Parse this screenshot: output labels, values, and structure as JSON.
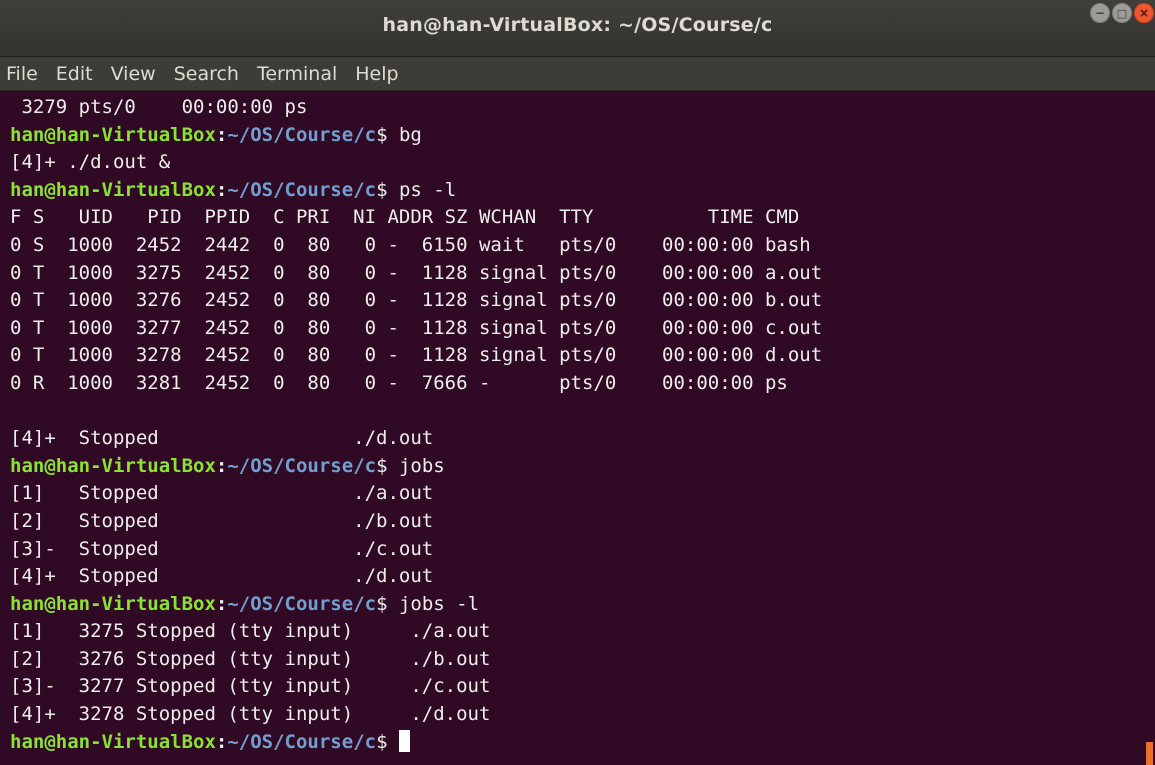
{
  "window": {
    "title": "han@han-VirtualBox: ~/OS/Course/c"
  },
  "menu": [
    "File",
    "Edit",
    "View",
    "Search",
    "Terminal",
    "Help"
  ],
  "prompt": {
    "user": "han@han-VirtualBox",
    "path": "~/OS/Course/c"
  },
  "lines": [
    {
      "text": " 3279 pts/0    00:00:00 ps"
    },
    {
      "user": "han@han-VirtualBox",
      "sep": ":",
      "path": "~/OS/Course/c",
      "cmd": "$ bg"
    },
    {
      "text": "[4]+ ./d.out &"
    },
    {
      "user": "han@han-VirtualBox",
      "sep": ":",
      "path": "~/OS/Course/c",
      "cmd": "$ ps -l"
    },
    {
      "text": "F S   UID   PID  PPID  C PRI  NI ADDR SZ WCHAN  TTY          TIME CMD"
    },
    {
      "text": "0 S  1000  2452  2442  0  80   0 -  6150 wait   pts/0    00:00:00 bash"
    },
    {
      "text": "0 T  1000  3275  2452  0  80   0 -  1128 signal pts/0    00:00:00 a.out"
    },
    {
      "text": "0 T  1000  3276  2452  0  80   0 -  1128 signal pts/0    00:00:00 b.out"
    },
    {
      "text": "0 T  1000  3277  2452  0  80   0 -  1128 signal pts/0    00:00:00 c.out"
    },
    {
      "text": "0 T  1000  3278  2452  0  80   0 -  1128 signal pts/0    00:00:00 d.out"
    },
    {
      "text": "0 R  1000  3281  2452  0  80   0 -  7666 -      pts/0    00:00:00 ps"
    },
    {
      "text": ""
    },
    {
      "text": "[4]+  Stopped                 ./d.out"
    },
    {
      "user": "han@han-VirtualBox",
      "sep": ":",
      "path": "~/OS/Course/c",
      "cmd": "$ jobs"
    },
    {
      "text": "[1]   Stopped                 ./a.out"
    },
    {
      "text": "[2]   Stopped                 ./b.out"
    },
    {
      "text": "[3]-  Stopped                 ./c.out"
    },
    {
      "text": "[4]+  Stopped                 ./d.out"
    },
    {
      "user": "han@han-VirtualBox",
      "sep": ":",
      "path": "~/OS/Course/c",
      "cmd": "$ jobs -l"
    },
    {
      "text": "[1]   3275 Stopped (tty input)     ./a.out"
    },
    {
      "text": "[2]   3276 Stopped (tty input)     ./b.out"
    },
    {
      "text": "[3]-  3277 Stopped (tty input)     ./c.out"
    },
    {
      "text": "[4]+  3278 Stopped (tty input)     ./d.out"
    },
    {
      "user": "han@han-VirtualBox",
      "sep": ":",
      "path": "~/OS/Course/c",
      "cmd": "$ ",
      "cursor": true
    }
  ],
  "colors": {
    "background": "#300a24",
    "prompt_user": "#8ae234",
    "prompt_path": "#729fcf",
    "text": "#eeeeec",
    "close_button": "#f0562e"
  },
  "icons": {
    "minimize": "minimize-icon",
    "maximize": "maximize-icon",
    "close": "close-icon"
  }
}
